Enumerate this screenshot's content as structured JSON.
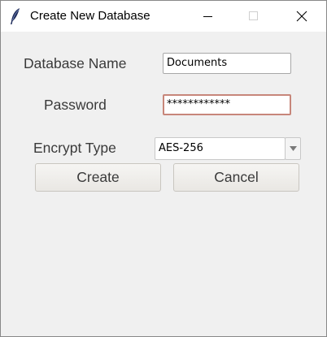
{
  "window": {
    "title": "Create New Database",
    "icon": "feather-icon"
  },
  "form": {
    "db_name_label": "Database Name",
    "db_name_value": "Documents",
    "password_label": "Password",
    "password_value": "************",
    "encrypt_label": "Encrypt Type",
    "encrypt_value": "AES-256"
  },
  "buttons": {
    "create": "Create",
    "cancel": "Cancel"
  }
}
